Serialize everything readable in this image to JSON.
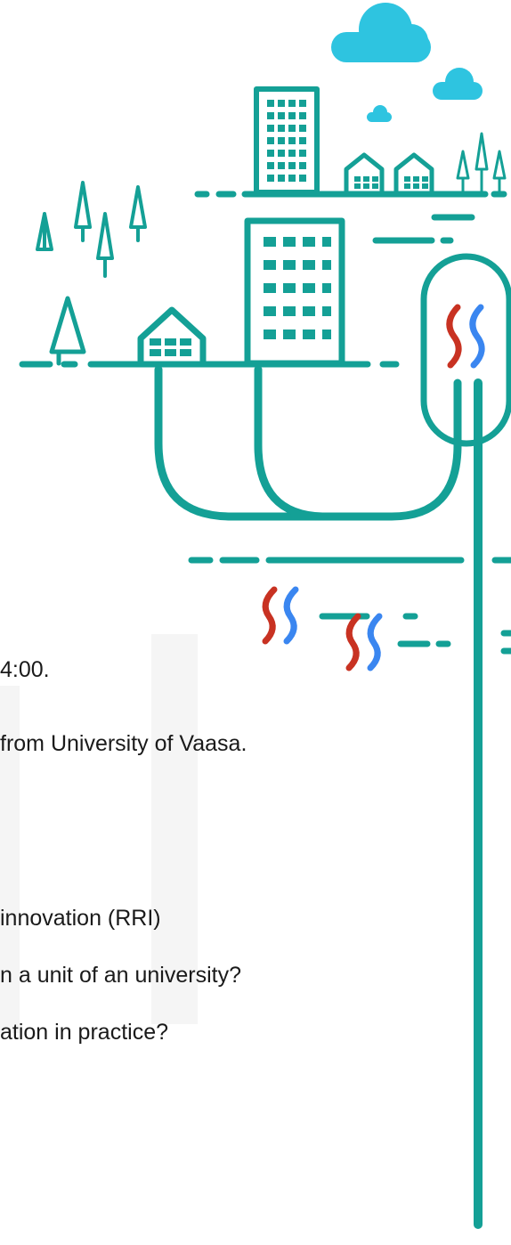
{
  "text_lines": [
    "4:00.",
    "from University of Vaasa.",
    "innovation (RRI)",
    "n a unit of an university?",
    "ation in practice?"
  ],
  "colors": {
    "teal": "#14a096",
    "cloud": "#2ec4e0",
    "heat_red": "#c83222",
    "heat_blue": "#3a86f0"
  }
}
